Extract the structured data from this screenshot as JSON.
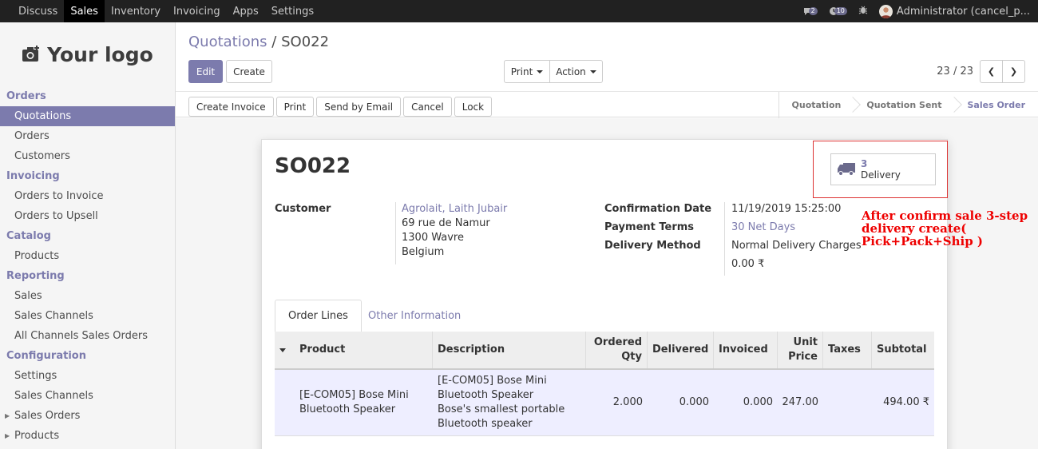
{
  "topbar": {
    "menu": [
      "Discuss",
      "Sales",
      "Inventory",
      "Invoicing",
      "Apps",
      "Settings"
    ],
    "active_menu": "Sales",
    "chat_count": "2",
    "activity_count": "10",
    "user": "Administrator (cancel_p..."
  },
  "sidebar": {
    "logo_text": "Your logo",
    "sections": [
      {
        "title": "Orders",
        "items": [
          "Quotations",
          "Orders",
          "Customers"
        ]
      },
      {
        "title": "Invoicing",
        "items": [
          "Orders to Invoice",
          "Orders to Upsell"
        ]
      },
      {
        "title": "Catalog",
        "items": [
          "Products"
        ]
      },
      {
        "title": "Reporting",
        "items": [
          "Sales",
          "Sales Channels",
          "All Channels Sales Orders"
        ]
      },
      {
        "title": "Configuration",
        "items": [
          "Settings",
          "Sales Channels",
          "Sales Orders",
          "Products"
        ]
      }
    ]
  },
  "breadcrumb": {
    "parent": "Quotations",
    "sep": "/",
    "current": "SO022"
  },
  "control_panel": {
    "edit": "Edit",
    "create": "Create",
    "print": "Print",
    "action": "Action",
    "pager": "23 / 23",
    "prev": "❮",
    "next": "❯"
  },
  "statusbar": {
    "buttons": [
      "Create Invoice",
      "Print",
      "Send by Email",
      "Cancel",
      "Lock"
    ],
    "stages": [
      "Quotation",
      "Quotation Sent",
      "Sales Order"
    ],
    "current_stage": "Sales Order"
  },
  "form": {
    "title": "SO022",
    "smart_button": {
      "count": "3",
      "label": "Delivery"
    },
    "customer_label": "Customer",
    "customer_name": "Agrolait, Laith Jubair",
    "customer_address": [
      "69 rue de Namur",
      "1300 Wavre",
      "Belgium"
    ],
    "confirmation_date_label": "Confirmation Date",
    "confirmation_date": "11/19/2019 15:25:00",
    "payment_terms_label": "Payment Terms",
    "payment_terms": "30 Net Days",
    "delivery_method_label": "Delivery Method",
    "delivery_method": "Normal Delivery Charges",
    "delivery_amount": "0.00 ₹"
  },
  "annotation": [
    "After confirm sale 3-step",
    "delivery create(",
    "Pick+Pack+Ship )"
  ],
  "tabs": [
    "Order Lines",
    "Other Information"
  ],
  "table": {
    "headers": {
      "product": "Product",
      "description": "Description",
      "ordered_qty": [
        "Ordered",
        "Qty"
      ],
      "delivered": "Delivered",
      "invoiced": "Invoiced",
      "unit_price": [
        "Unit",
        "Price"
      ],
      "taxes": "Taxes",
      "subtotal": "Subtotal"
    },
    "rows": [
      {
        "product": [
          "[E-COM05] Bose Mini",
          "Bluetooth Speaker"
        ],
        "description": [
          "[E-COM05] Bose Mini",
          "Bluetooth Speaker",
          "Bose's smallest portable",
          "Bluetooth speaker"
        ],
        "ordered_qty": "2.000",
        "delivered": "0.000",
        "invoiced": "0.000",
        "unit_price": "247.00",
        "taxes": "",
        "subtotal": "494.00 ₹"
      }
    ]
  }
}
